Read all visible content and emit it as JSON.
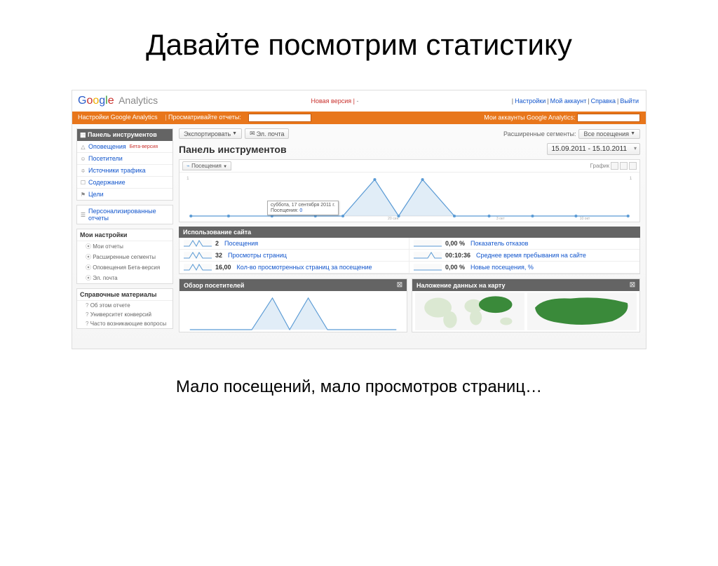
{
  "slide": {
    "title": "Давайте посмотрим статистику",
    "caption": "Мало посещений, мало просмотров страниц…"
  },
  "header": {
    "logo_analytics": "Analytics",
    "new_version": "Новая версия",
    "links": {
      "settings": "Настройки",
      "account": "Мой аккаунт",
      "help": "Справка",
      "logout": "Выйти"
    }
  },
  "orangebar": {
    "settings": "Настройки Google Analytics",
    "view_reports": "Просматривайте отчеты:",
    "my_accounts": "Мои аккаунты Google Analytics:"
  },
  "sidebar": {
    "panel_head": "Панель инструментов",
    "items": [
      {
        "label": "Оповещения",
        "badge": "Бета-версия"
      },
      {
        "label": "Посетители",
        "badge": ""
      },
      {
        "label": "Источники трафика",
        "badge": ""
      },
      {
        "label": "Содержание",
        "badge": ""
      },
      {
        "label": "Цели",
        "badge": ""
      }
    ],
    "custom_reports": "Персонализированные отчеты",
    "my_settings": "Мои настройки",
    "my_settings_items": [
      {
        "label": "Мои отчеты",
        "badge": ""
      },
      {
        "label": "Расширенные сегменты",
        "badge": ""
      },
      {
        "label": "Оповещения",
        "badge": "Бета-версия"
      },
      {
        "label": "Эл. почта",
        "badge": ""
      }
    ],
    "help": "Справочные материалы",
    "help_items": [
      "Об этом отчете",
      "Университет конверсий",
      "Часто возникающие вопросы"
    ]
  },
  "toolbar": {
    "export": "Экспортировать",
    "email": "Эл. почта",
    "adv_segments": "Расширенные сегменты:",
    "all_visits": "Все посещения"
  },
  "main": {
    "title": "Панель инструментов",
    "date_range": "15.09.2011 - 15.10.2011",
    "chart_tab": "Посещения",
    "graph_label": "График",
    "tooltip_date": "суббота, 17 сентября 2011 г.",
    "tooltip_metric": "Посещения:",
    "tooltip_value": "0",
    "usage_title": "Использование сайта",
    "metrics": [
      {
        "value": "2",
        "label": "Посещения"
      },
      {
        "value": "0,00 %",
        "label": "Показатель отказов"
      },
      {
        "value": "32",
        "label": "Просмотры страниц"
      },
      {
        "value": "00:10:36",
        "label": "Среднее время пребывания на сайте"
      },
      {
        "value": "16,00",
        "label": "Кол-во просмотренных страниц за посещение"
      },
      {
        "value": "0,00 %",
        "label": "Новые посещения, %"
      }
    ],
    "overview_title": "Обзор посетителей",
    "map_title": "Наложение данных на карту"
  },
  "chart_data": {
    "type": "line",
    "xrange": [
      "2011-09-15",
      "2011-10-15"
    ],
    "y_metric": "Посещения",
    "y_max": 1,
    "series": [
      {
        "name": "Посещения",
        "points": [
          {
            "x": "2011-09-15",
            "y": 0
          },
          {
            "x": "2011-09-17",
            "y": 0
          },
          {
            "x": "2011-09-22",
            "y": 1
          },
          {
            "x": "2011-09-26",
            "y": 1
          },
          {
            "x": "2011-10-15",
            "y": 0
          }
        ]
      }
    ],
    "xticks": [
      "20 сен",
      "3 окт",
      "10 окт"
    ]
  }
}
